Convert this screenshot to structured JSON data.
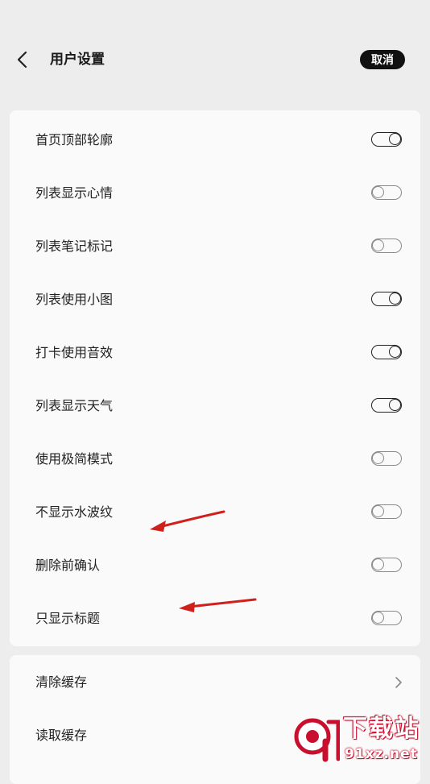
{
  "header": {
    "title": "用户设置",
    "cancel_label": "取消"
  },
  "settings": [
    {
      "label": "首页顶部轮廓",
      "state": "on"
    },
    {
      "label": "列表显示心情",
      "state": "off"
    },
    {
      "label": "列表笔记标记",
      "state": "off"
    },
    {
      "label": "列表使用小图",
      "state": "on"
    },
    {
      "label": "打卡使用音效",
      "state": "on"
    },
    {
      "label": "列表显示天气",
      "state": "on"
    },
    {
      "label": "使用极简模式",
      "state": "off"
    },
    {
      "label": "不显示水波纹",
      "state": "off"
    },
    {
      "label": "删除前确认",
      "state": "off"
    },
    {
      "label": "只显示标题",
      "state": "off"
    }
  ],
  "cache": {
    "clear_label": "清除缓存",
    "read_label": "读取缓存"
  },
  "watermark": {
    "brand": "下载站",
    "domain": "91xz.net",
    "logo_text": "9"
  },
  "colors": {
    "background": "#ededed",
    "card": "#fafafa",
    "toggle_on": "#222222",
    "toggle_off": "#8a8a8a",
    "annotation_arrow": "#d0201c",
    "watermark_red": "#c8102e"
  }
}
